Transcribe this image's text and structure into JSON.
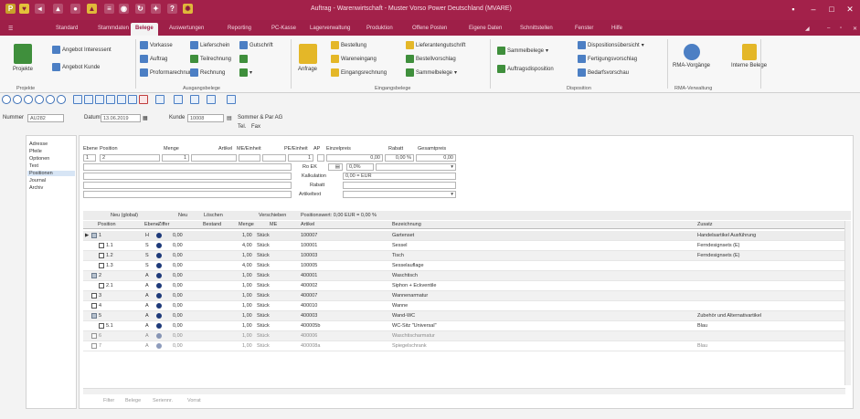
{
  "window": {
    "title": "Auftrag - Warenwirtschaft - Muster Vorso Power Deutschland (MVARE)"
  },
  "menu": {
    "items": [
      {
        "label": "Standard"
      },
      {
        "label": "Stammdaten"
      },
      {
        "label": "Belege"
      },
      {
        "label": "Auswertungen"
      },
      {
        "label": "Reporting"
      },
      {
        "label": "PC-Kasse"
      },
      {
        "label": "Lagerverwaltung"
      },
      {
        "label": "Produktion"
      },
      {
        "label": "Offene Posten"
      },
      {
        "label": "Eigene Daten"
      },
      {
        "label": "Schnittstellen"
      },
      {
        "label": "Fenster"
      },
      {
        "label": "Hilfe"
      }
    ]
  },
  "ribbon": {
    "projekte": "Projekte",
    "angebot_interessent": "Angebot Interessent",
    "angebot_kunde": "Angebot Kunde",
    "vorkasse": "Vorkasse",
    "lieferschein": "Lieferschein",
    "gutschrift": "Gutschrift",
    "auftrag": "Auftrag",
    "teilrechnung": "Teilrechnung",
    "proformarechnung": "Proformarechnung",
    "rechnung": "Rechnung",
    "anfrage": "Anfrage",
    "bestellung": "Bestellung",
    "wareneingang": "Wareneingang",
    "eingangsrechnung": "Eingangsrechnung",
    "lieferantengutschrift": "Lieferantengutschrift",
    "bestellvorschlag": "Bestellvorschlag",
    "sammelbelege": "Sammelbelege",
    "sammelbelege_2": "Sammelbelege",
    "auftragsdisposition": "Auftragsdisposition",
    "dispositionsubersicht": "Dispositionsübersicht",
    "fertigungsvorschlag": "Fertigungsvorschlag",
    "bedarfsvorschau": "Bedarfsvorschau",
    "rma_vorgange": "RMA-Vorgänge",
    "interne_belege": "Interne Belege",
    "group_projekte": "Projekte",
    "group_ausgangsbelege": "Ausgangsbelege",
    "group_eingangsbelege": "Eingangsbelege",
    "group_disposition": "Disposition",
    "group_rma": "RMA-Verwaltung"
  },
  "doc": {
    "nummer_label": "Nummer",
    "nummer_value": "AU282",
    "datum_label": "Datum",
    "datum_value": "13.06.2019",
    "kunde_label": "Kunde",
    "kunde_value": "10008",
    "kunde_name": "Sommer & Par AG",
    "tel": "Tel.",
    "fax": "Fax"
  },
  "nav": {
    "items": [
      {
        "label": "Adresse"
      },
      {
        "label": "Pfeile"
      },
      {
        "label": "Optionen"
      },
      {
        "label": "Text"
      },
      {
        "label": "Positionen"
      },
      {
        "label": "Journal"
      },
      {
        "label": "Archiv"
      }
    ]
  },
  "form": {
    "ebene": "Ebene",
    "position": "Position",
    "menge": "Menge",
    "artikel": "Artikel",
    "mengeneinheit": "ME/Einheit",
    "preis_einheit": "PE/Einheit",
    "ap": "AP",
    "einzelpreis": "Einzelpreis",
    "rabatt": "Rabatt",
    "gesamtpreis": "Gesamtpreis",
    "r1_ebene": "1",
    "r1_pos": "2",
    "r1_menge": "1",
    "r1_preis": "1",
    "r1_einzel": "0,00",
    "r1_rabatt": "0,00 %",
    "r1_gesamt": "0,00",
    "ro_ek": "Ro EK",
    "ro_ek_value": "0,0%",
    "kalkulation": "Kalkulation",
    "kalk_value": "0,00 = EUR",
    "rabatt_label": "Rabatt",
    "artikeltext": "Artikeltext"
  },
  "lower_toolbar": {
    "neu_label": "Neu (global)",
    "neu2": "Neu",
    "loeschen": "Löschen",
    "verschieben": "Verschieben",
    "positionswert": "Positionswert:  0,00 EUR = 0,00 %"
  },
  "table": {
    "headers": [
      "Position",
      "Ebene",
      "Ziffer",
      "Bestand",
      "Menge",
      "ME",
      "Artikel",
      "Bezeichnung",
      "Zusatz"
    ],
    "rows": [
      {
        "pos": "1",
        "ebene": "H",
        "ziffer": "0,00",
        "menge": "1,00",
        "me": "Stück",
        "artikel": "100007",
        "bez": "Gartenset",
        "zusatz": "Handelsartikel Ausführung"
      },
      {
        "pos": "1.1",
        "ebene": "S",
        "ziffer": "0,00",
        "menge": "4,00",
        "me": "Stück",
        "artikel": "100001",
        "bez": "Sessel",
        "zusatz": "Ferndesignsets (E)"
      },
      {
        "pos": "1.2",
        "ebene": "S",
        "ziffer": "0,00",
        "menge": "1,00",
        "me": "Stück",
        "artikel": "100003",
        "bez": "Tisch",
        "zusatz": "Ferndesignsets (E)"
      },
      {
        "pos": "1.3",
        "ebene": "S",
        "ziffer": "0,00",
        "menge": "4,00",
        "me": "Stück",
        "artikel": "100005",
        "bez": "Sesselauflage",
        "zusatz": ""
      },
      {
        "pos": "2",
        "ebene": "A",
        "ziffer": "0,00",
        "menge": "1,00",
        "me": "Stück",
        "artikel": "400001",
        "bez": "Waschtisch",
        "zusatz": ""
      },
      {
        "pos": "2.1",
        "ebene": "A",
        "ziffer": "0,00",
        "menge": "1,00",
        "me": "Stück",
        "artikel": "400002",
        "bez": "Siphon + Eckventile",
        "zusatz": ""
      },
      {
        "pos": "3",
        "ebene": "A",
        "ziffer": "0,00",
        "menge": "1,00",
        "me": "Stück",
        "artikel": "400007",
        "bez": "Wannenarmatur",
        "zusatz": ""
      },
      {
        "pos": "4",
        "ebene": "A",
        "ziffer": "0,00",
        "menge": "1,00",
        "me": "Stück",
        "artikel": "400010",
        "bez": "Wanne",
        "zusatz": ""
      },
      {
        "pos": "5",
        "ebene": "A",
        "ziffer": "0,00",
        "menge": "1,00",
        "me": "Stück",
        "artikel": "400003",
        "bez": "Wand-WC",
        "zusatz": "Zubehör und Alternativartikel"
      },
      {
        "pos": "5.1",
        "ebene": "A",
        "ziffer": "0,00",
        "menge": "1,00",
        "me": "Stück",
        "artikel": "400005b",
        "bez": "WC-Sitz \"Universal\"",
        "zusatz": "Blau"
      },
      {
        "pos": "6",
        "ebene": "A",
        "ziffer": "0,00",
        "menge": "1,00",
        "me": "Stück",
        "artikel": "400006",
        "bez": "Waschtischarmatur",
        "zusatz": ""
      },
      {
        "pos": "7",
        "ebene": "A",
        "ziffer": "0,00",
        "menge": "1,00",
        "me": "Stück",
        "artikel": "400008a",
        "bez": "Spiegelschrank",
        "zusatz": "Blau"
      }
    ]
  },
  "bottom_tabs": [
    "Filter",
    "Belege",
    "Seriennr.",
    "Vorrat"
  ],
  "colors": {
    "accent": "#a3214a",
    "selection": "#d7e5f5"
  }
}
